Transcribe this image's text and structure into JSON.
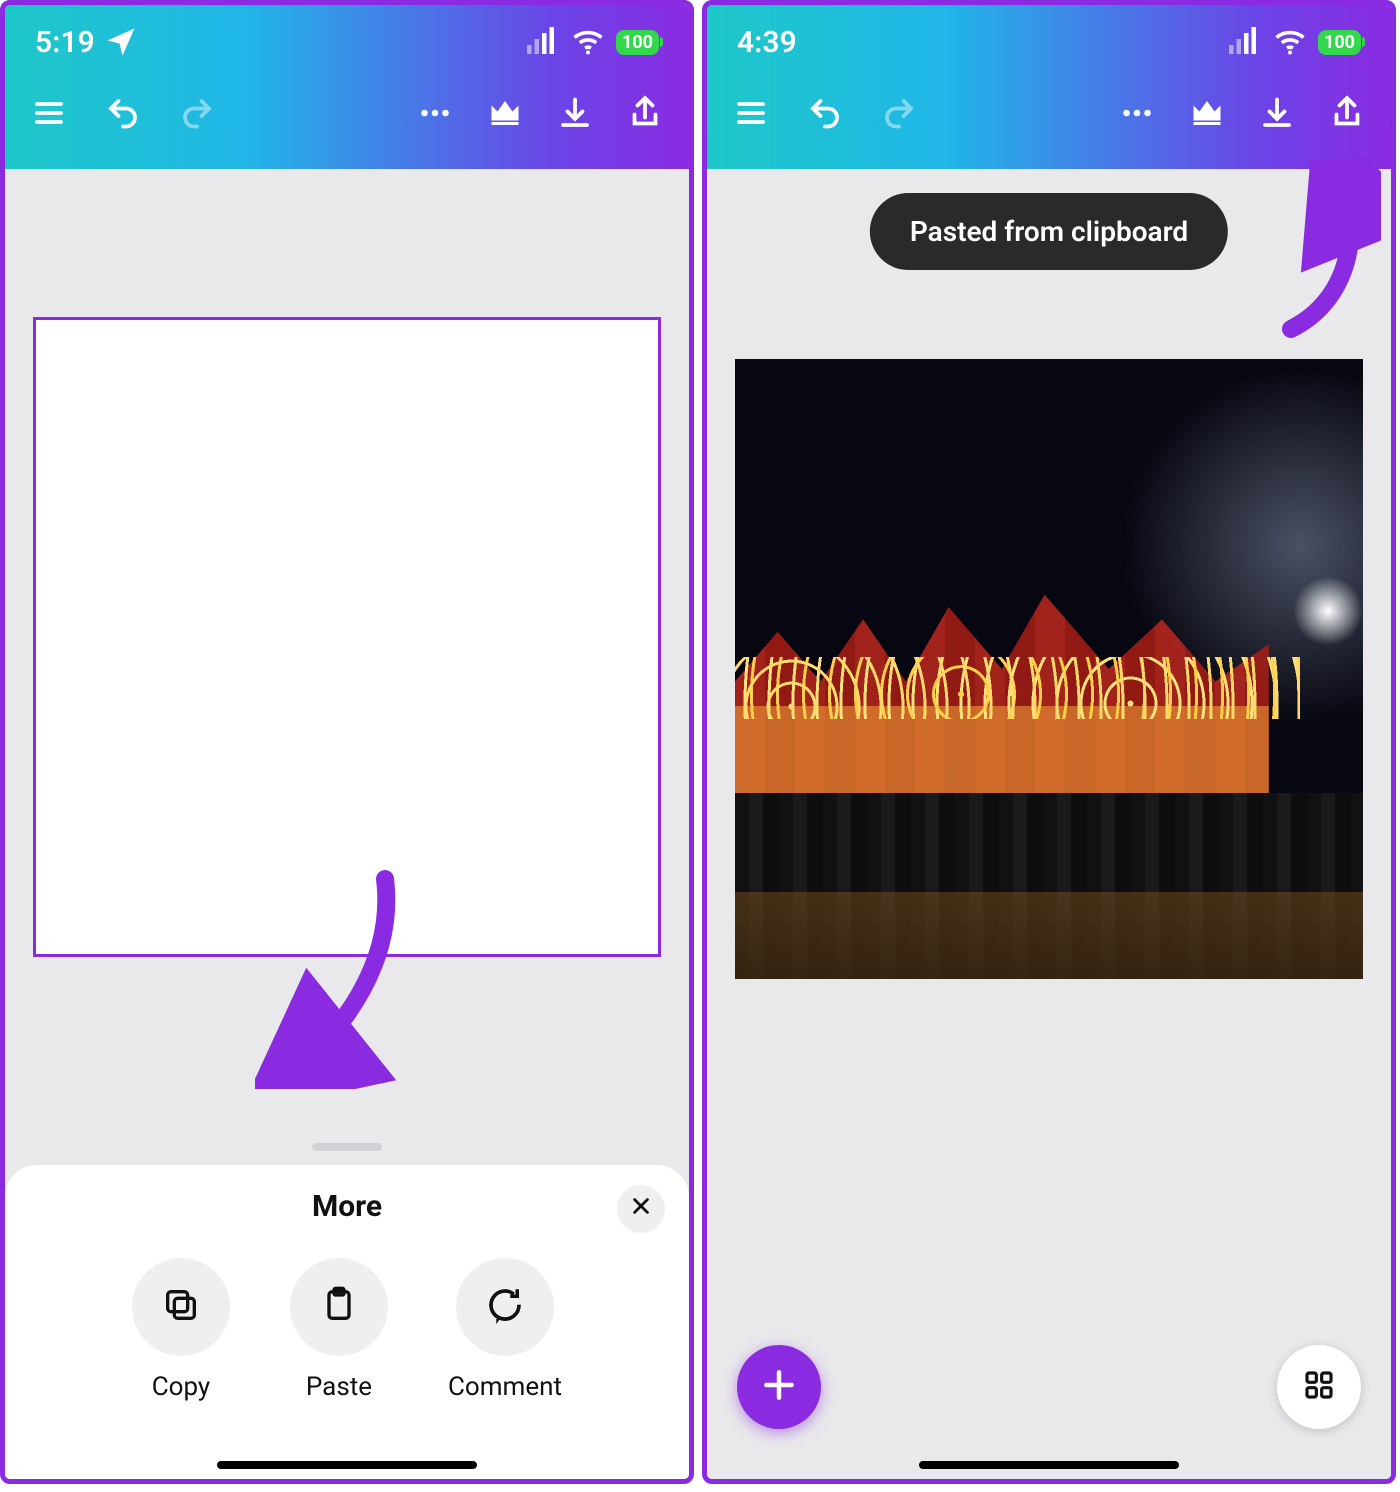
{
  "panels": {
    "left": {
      "status": {
        "time": "5:19",
        "battery": "100"
      },
      "sheet": {
        "title": "More",
        "actions": [
          {
            "key": "copy",
            "label": "Copy"
          },
          {
            "key": "paste",
            "label": "Paste"
          },
          {
            "key": "comment",
            "label": "Comment"
          }
        ]
      }
    },
    "right": {
      "status": {
        "time": "4:39",
        "battery": "100"
      },
      "toast": "Pasted from clipboard"
    }
  },
  "toolbar_icons": [
    "menu",
    "undo",
    "redo",
    "more",
    "crown",
    "download",
    "share"
  ],
  "colors": {
    "accent": "#8a2be2",
    "teal": "#1ec8c8",
    "battery": "#32d74b"
  }
}
